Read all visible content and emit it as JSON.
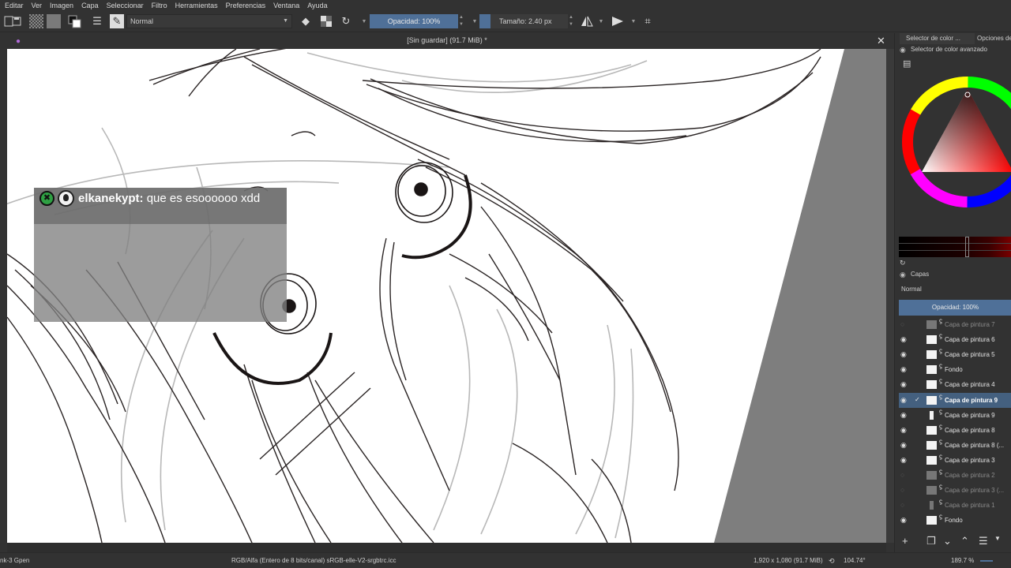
{
  "menubar": [
    "Editar",
    "Ver",
    "Imagen",
    "Capa",
    "Seleccionar",
    "Filtro",
    "Herramientas",
    "Preferencias",
    "Ventana",
    "Ayuda"
  ],
  "toolbar": {
    "blend_mode": "Normal",
    "opacity": "Opacidad: 100%",
    "size": "Tamaño: 2.40 px"
  },
  "document": {
    "title": "[Sin guardar]  (91.7 MiB) *",
    "close": "✕"
  },
  "chat": {
    "username": "elkanekypt:",
    "message": " que es esoooooo xdd",
    "badge_color": "#2ea043"
  },
  "docker": {
    "tabs": [
      "Selector de color ...",
      "Opciones de"
    ],
    "color_selector_title": "Selector de color avanzado",
    "layers_title": "Capas",
    "layer_blend": "Normal",
    "layer_opacity": "Opacidad:  100%",
    "layers": [
      {
        "name": "Capa de pintura 7",
        "visible": false,
        "selected": false,
        "thumb": "grey"
      },
      {
        "name": "Capa de pintura 6",
        "visible": true,
        "selected": false,
        "thumb": "white"
      },
      {
        "name": "Capa de pintura 5",
        "visible": true,
        "selected": false,
        "thumb": "white"
      },
      {
        "name": "Fondo",
        "visible": true,
        "selected": false,
        "thumb": "white"
      },
      {
        "name": "Capa de pintura 4",
        "visible": true,
        "selected": false,
        "thumb": "white"
      },
      {
        "name": "Capa de pintura 9",
        "visible": true,
        "selected": true,
        "thumb": "white"
      },
      {
        "name": "Capa de pintura 9",
        "visible": true,
        "selected": false,
        "thumb": "narrow"
      },
      {
        "name": "Capa de pintura 8",
        "visible": true,
        "selected": false,
        "thumb": "white"
      },
      {
        "name": "Capa de pintura 8 (...",
        "visible": true,
        "selected": false,
        "thumb": "white"
      },
      {
        "name": "Capa de pintura 3",
        "visible": true,
        "selected": false,
        "thumb": "white"
      },
      {
        "name": "Capa de pintura 2",
        "visible": false,
        "selected": false,
        "thumb": "grey"
      },
      {
        "name": "Capa de pintura 3 (...",
        "visible": false,
        "selected": false,
        "thumb": "grey"
      },
      {
        "name": "Capa de pintura 1",
        "visible": false,
        "selected": false,
        "thumb": "narrow-grey"
      },
      {
        "name": "Fondo",
        "visible": true,
        "selected": false,
        "thumb": "white"
      }
    ],
    "accent": "#4f7098"
  },
  "statusbar": {
    "brush": "nk-3 Gpen",
    "color_model": "RGB/Alfa (Entero de 8 bits/canal)  sRGB-elle-V2-srgbtrc.icc",
    "dimensions": "1,920 x 1,080 (91.7 MiB)",
    "rotation": "104.74°",
    "zoom": "189.7 %"
  }
}
